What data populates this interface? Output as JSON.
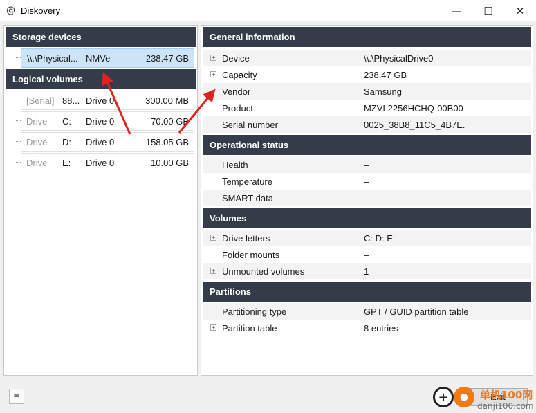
{
  "window": {
    "title": "Diskovery",
    "app_icon": "@"
  },
  "controls": {
    "minimize": "—",
    "maximize": "☐",
    "close": "✕"
  },
  "left": {
    "storage_header": "Storage devices",
    "storage_devices": [
      {
        "name": "\\\\.\\Physical...",
        "type": "NMVe",
        "size": "238.47 GB"
      }
    ],
    "volumes_header": "Logical volumes",
    "volumes": [
      {
        "kind": "[Serial]",
        "id": "88...",
        "drive": "Drive 0",
        "size": "300.00 MB"
      },
      {
        "kind": "Drive",
        "id": "C:",
        "drive": "Drive 0",
        "size": "70.00 GB"
      },
      {
        "kind": "Drive",
        "id": "D:",
        "drive": "Drive 0",
        "size": "158.05 GB"
      },
      {
        "kind": "Drive",
        "id": "E:",
        "drive": "Drive 0",
        "size": "10.00 GB"
      }
    ]
  },
  "right": {
    "general": {
      "header": "General information",
      "rows": [
        {
          "label": "Device",
          "value": "\\\\.\\PhysicalDrive0",
          "expandable": true
        },
        {
          "label": "Capacity",
          "value": "238.47 GB",
          "expandable": true
        },
        {
          "label": "Vendor",
          "value": "Samsung",
          "expandable": false
        },
        {
          "label": "Product",
          "value": "MZVL2256HCHQ-00B00",
          "expandable": false
        },
        {
          "label": "Serial number",
          "value": "0025_38B8_11C5_4B7E.",
          "expandable": false
        }
      ]
    },
    "operational": {
      "header": "Operational status",
      "rows": [
        {
          "label": "Health",
          "value": "–"
        },
        {
          "label": "Temperature",
          "value": "–"
        },
        {
          "label": "SMART data",
          "value": "–"
        }
      ]
    },
    "volumes": {
      "header": "Volumes",
      "rows": [
        {
          "label": "Drive letters",
          "value": "C:  D:  E:",
          "expandable": true
        },
        {
          "label": "Folder mounts",
          "value": "–",
          "expandable": false
        },
        {
          "label": "Unmounted volumes",
          "value": "1",
          "expandable": true
        }
      ]
    },
    "partitions": {
      "header": "Partitions",
      "rows": [
        {
          "label": "Partitioning type",
          "value": "GPT / GUID partition table",
          "expandable": false
        },
        {
          "label": "Partition table",
          "value": "8 entries",
          "expandable": true
        }
      ]
    }
  },
  "footer": {
    "menu_icon": "≡",
    "exit_label": "Exit"
  },
  "watermark": {
    "text_main": "单机100网",
    "text_url": "danji100.com",
    "icon_plus": "+"
  },
  "colors": {
    "header_bg": "#343c4a",
    "selection": "#cce4f7",
    "arrow": "#e0231c",
    "watermark": "#f07a14"
  }
}
